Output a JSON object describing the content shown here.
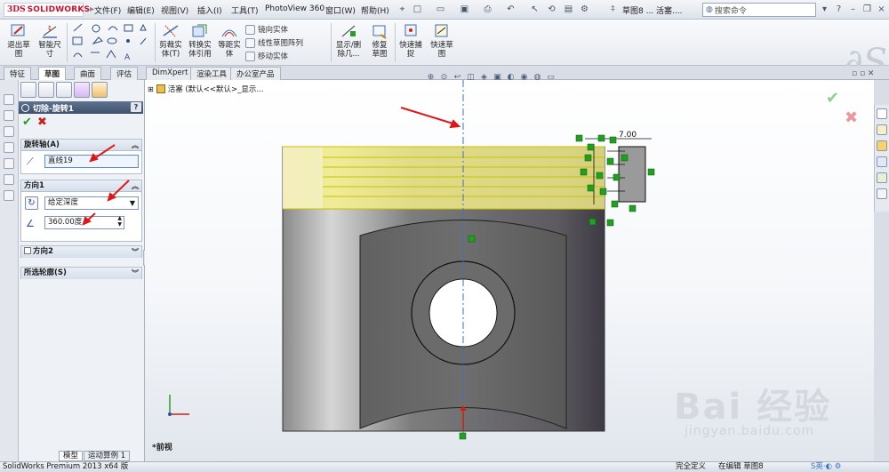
{
  "app": {
    "logo_prefix": "3DS",
    "logo_name": "SOLIDWORKS"
  },
  "menu": [
    "文件(F)",
    "编辑(E)",
    "视图(V)",
    "插入(I)",
    "工具(T)",
    "PhotoView 360",
    "窗口(W)",
    "帮助(H)"
  ],
  "doc_title": "草图8 ... 活塞....",
  "search": {
    "placeholder": "搜索命令"
  },
  "command_manager": {
    "exit_sketch": "退出草图",
    "smart_dim": "智能尺寸",
    "trim": "剪裁实体(T)",
    "convert": "转换实体引用",
    "offset": "等距实体",
    "mirror": "镜向实体",
    "linear_pattern": "线性草图阵列",
    "move": "移动实体",
    "display_delete": "显示/删除几...",
    "repair": "修复草图",
    "quick_snap": "快速捕捉",
    "rapid_sketch": "快速草图"
  },
  "tabs": [
    "特征",
    "草图",
    "曲面",
    "评估",
    "DimXpert",
    "渲染工具",
    "办公室产品"
  ],
  "active_tab": "草图",
  "property_manager": {
    "title": "切除-旋转1",
    "help": "?",
    "axis_group": "旋转轴(A)",
    "axis_value": "直线19",
    "dir1_group": "方向1",
    "end_condition": "给定深度",
    "angle": "360.00度",
    "dir2_group": "方向2",
    "contours_group": "所选轮廓(S)"
  },
  "tree_item": "活塞 (默认<<默认>_显示...",
  "view_label": "*前视",
  "bottom_tabs": [
    "模型",
    "运动算例 1"
  ],
  "dimension": "7.00",
  "status": {
    "left": "SolidWorks Premium 2013 x64 版",
    "defined": "完全定义",
    "editing": "在编辑 草图8"
  },
  "watermark": {
    "logo": "Bai 经验",
    "url": "jingyan.baidu.com"
  },
  "colors": {
    "selection_yellow": "#f5f08a",
    "part_gray": "#6d6d6d",
    "sketch_green": "#1fa01f",
    "arrow_red": "#e01515"
  }
}
